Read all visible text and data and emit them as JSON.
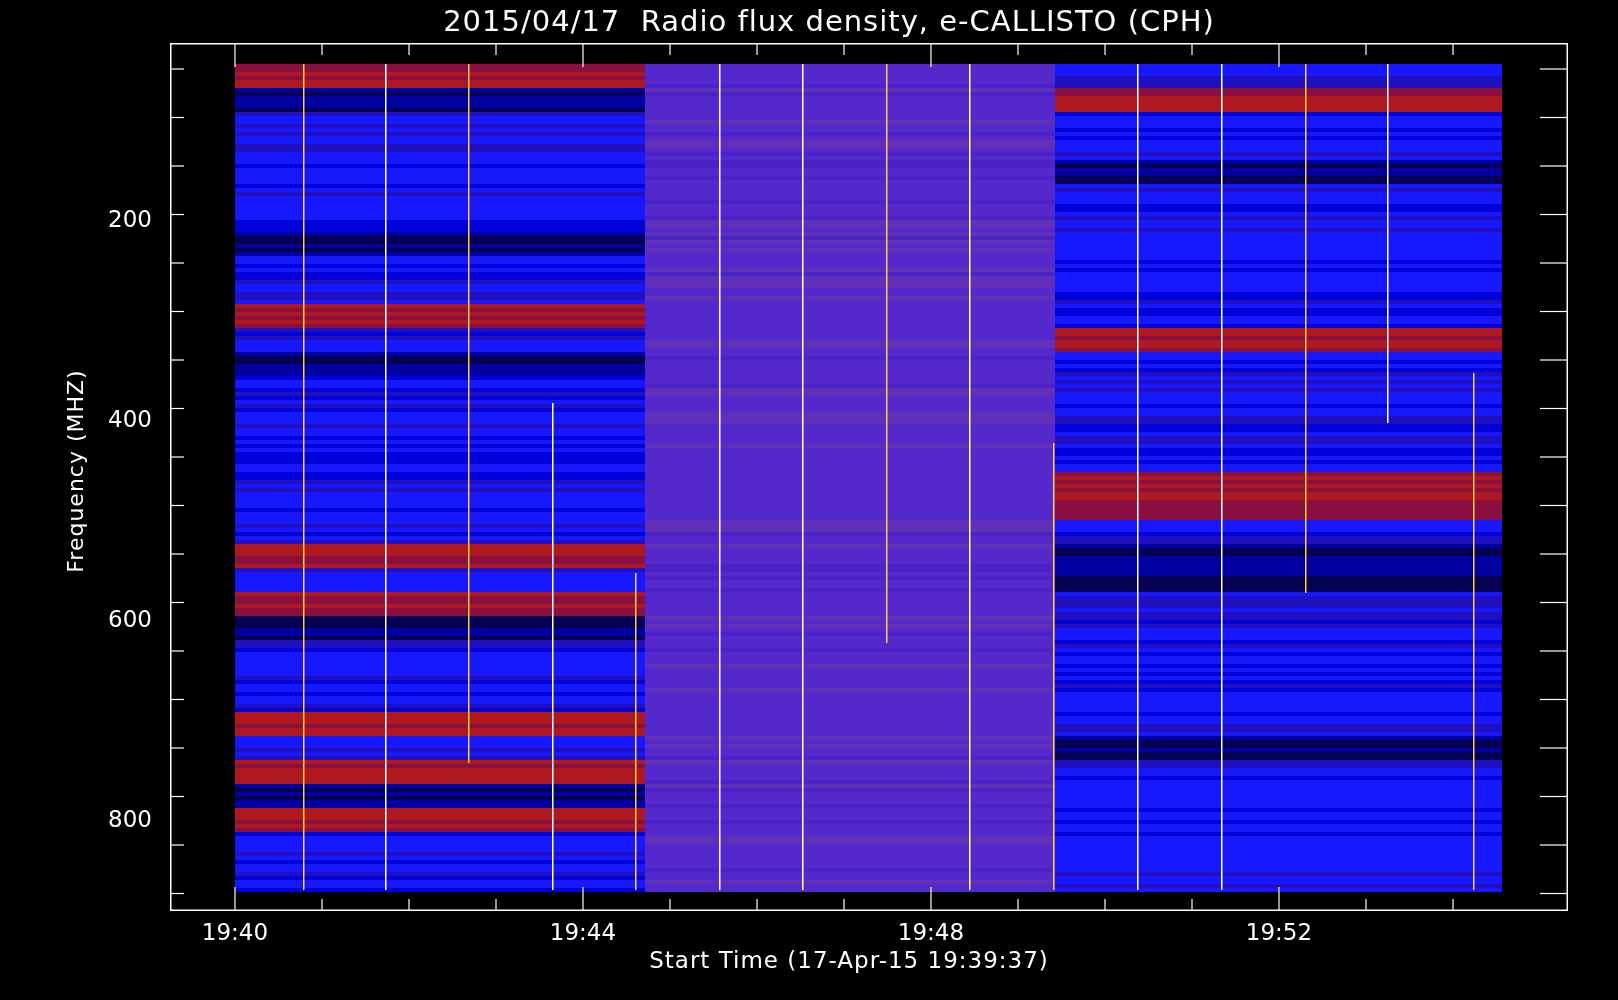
{
  "title": "2015/04/17  Radio flux density, e-CALLISTO (CPH)",
  "y_axis": {
    "label": "Frequency (MHZ)",
    "tick_labels": [
      "200",
      "400",
      "600",
      "800"
    ]
  },
  "x_axis": {
    "label": "Start Time (17-Apr-15 19:39:37)",
    "tick_labels": [
      "19:40",
      "19:44",
      "19:48",
      "19:52"
    ]
  }
}
